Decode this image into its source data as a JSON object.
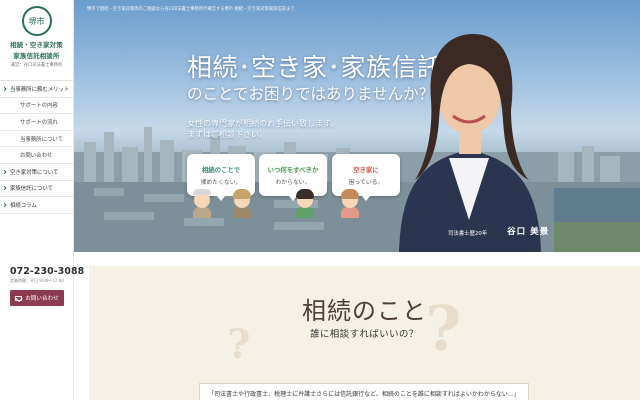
{
  "sidebar": {
    "logo": {
      "mark": "堺市",
      "line1": "相続・空き家対策",
      "line2": "家族信託相談所",
      "sub": "運営：谷口司法書士事務所"
    },
    "nav": [
      {
        "label": "当事務所に頼むメリット",
        "kind": "main"
      },
      {
        "label": "サポートの内容",
        "kind": "sub"
      },
      {
        "label": "サポートの流れ",
        "kind": "sub"
      },
      {
        "label": "当事務所について",
        "kind": "sub"
      },
      {
        "label": "お問い合わせ",
        "kind": "sub"
      },
      {
        "label": "空き家対策について",
        "kind": "main"
      },
      {
        "label": "家族信託について",
        "kind": "main"
      },
      {
        "label": "相続コラム",
        "kind": "main"
      }
    ],
    "phone": "072-230-3088",
    "hours": "営業時間：平日 9:00〜17:00",
    "contact_label": "お問い合わせ"
  },
  "hero": {
    "notice": "堺市で相続・空き家対策等のご相談なら谷口司法書士事務所が運営する堺市 相続・空き家対策家族信託まで",
    "title": "相続･空き家･家族信託",
    "subtitle": "のことでお困りではありませんか？",
    "desc1": "女性の専門家が相続のお手伝い致します。",
    "desc2": "まずはご相談下さい。",
    "bubbles": [
      {
        "line1": "相続のことで",
        "line2": "揉めたくない。"
      },
      {
        "line1": "いつ何をすべきか",
        "line2": "わからない。"
      },
      {
        "line1": "空き家に",
        "line2": "困っている。"
      }
    ],
    "person_title": "司法書士歴20年",
    "person_name": "谷口 美景"
  },
  "section": {
    "title": "相続のこと",
    "subtitle": "誰に相談すればいいの？",
    "qmark": "?",
    "box_text": "「司法書士や行政書士、税理士に弁護士さらには信託銀行など、相続のことを誰に相談すればよいかわからない…」"
  },
  "colors": {
    "brand_green": "#2e6f5a",
    "contact_button": "#8b3a50",
    "section_bg": "#f6f1e7"
  }
}
